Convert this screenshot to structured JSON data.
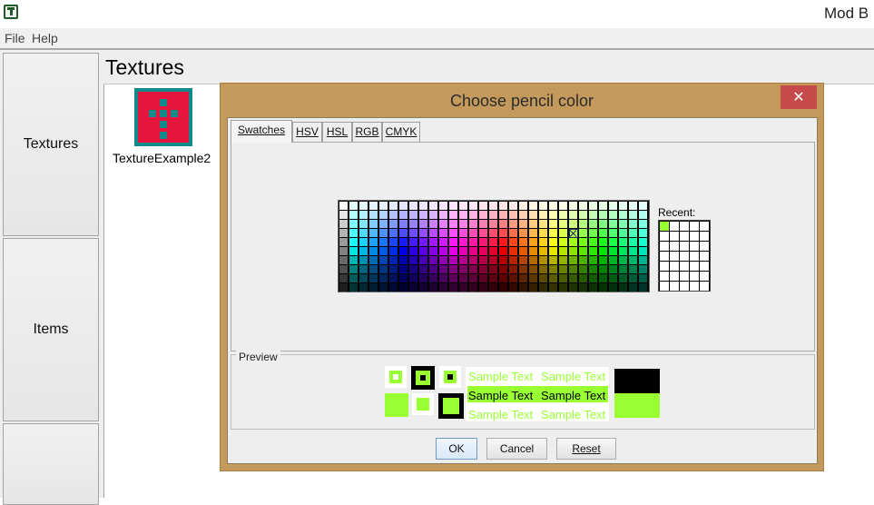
{
  "window": {
    "title": "Mod B"
  },
  "menu": [
    {
      "label": "File"
    },
    {
      "label": "Help"
    }
  ],
  "nav": [
    {
      "label": "Textures"
    },
    {
      "label": "Items"
    },
    {
      "label": ""
    }
  ],
  "panel": {
    "title": "Textures",
    "texture": {
      "name": "TextureExample2",
      "bg_color": "#e6153e",
      "pattern_color": "#12898a"
    }
  },
  "dialog": {
    "title": "Choose pencil color",
    "close_glyph": "✕",
    "tabs": [
      {
        "label": "Swatches",
        "active": true
      },
      {
        "label": "HSV",
        "active": false
      },
      {
        "label": "HSL",
        "active": false
      },
      {
        "label": "RGB",
        "active": false
      },
      {
        "label": "CMYK",
        "active": false
      }
    ],
    "recent_label": "Recent:",
    "recent_colors": [
      "#99ff33"
    ],
    "preview_label": "Preview",
    "sample_text": "Sample Text",
    "selected_color": "#99ff33",
    "buttons": {
      "ok": "OK",
      "cancel": "Cancel",
      "reset": "Reset"
    }
  }
}
